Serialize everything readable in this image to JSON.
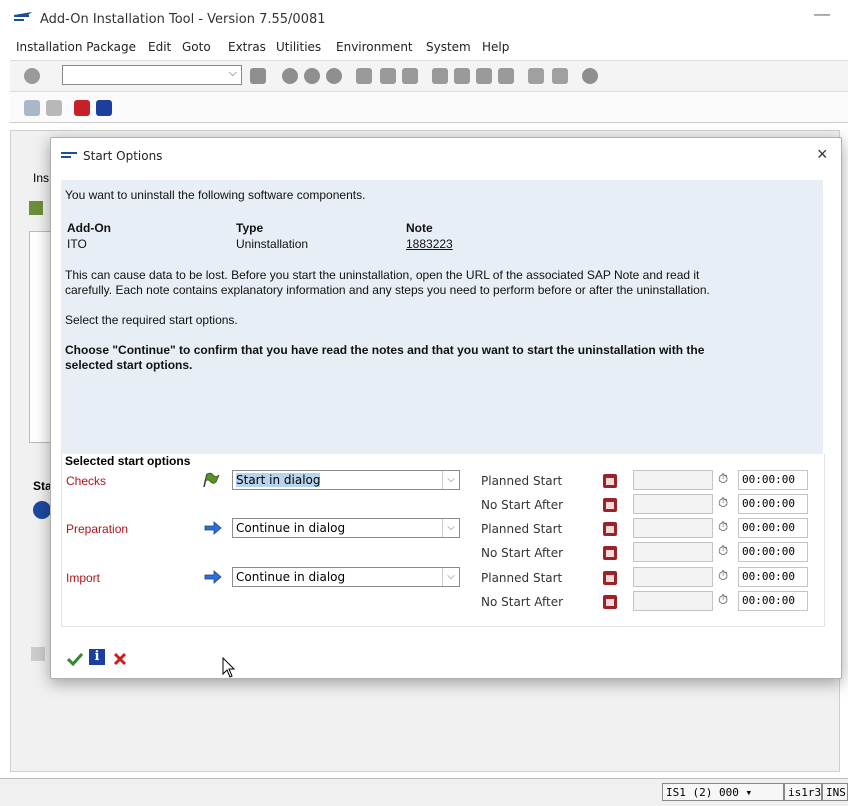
{
  "window": {
    "title": "Add-On Installation Tool - Version 7.55/0081",
    "minimize": "—"
  },
  "menu": [
    "Installation Package",
    "Edit",
    "Goto",
    "Extras",
    "Utilities",
    "Environment",
    "System",
    "Help"
  ],
  "background": {
    "tab_fragment": "Ins",
    "status_fragment": "Sta"
  },
  "statusbar": {
    "system": "IS1 (2) 000",
    "server": "is1r3",
    "mode": "INS"
  },
  "dialog": {
    "title": "Start Options",
    "close": "×",
    "intro": "You want to uninstall the following software components.",
    "columns": {
      "addon": "Add-On",
      "type": "Type",
      "note": "Note"
    },
    "row": {
      "addon": "ITO",
      "type": "Uninstallation",
      "note": "1883223"
    },
    "warning_line1": "This can cause data to be lost. Before you start the uninstallation, open the URL of the associated SAP Note and read it",
    "warning_line2": "carefully. Each note contains explanatory information and any steps you need to perform before or after the uninstallation.",
    "select_hint": "Select the required start options.",
    "confirm_line1": "Choose \"Continue\" to confirm that you have read the notes and that you want to start the uninstallation with the",
    "confirm_line2": "selected start options.",
    "options_header": "Selected start options",
    "phases": [
      {
        "name": "Checks",
        "mode": "Start in dialog",
        "icon": "flag-icon"
      },
      {
        "name": "Preparation",
        "mode": "Continue in dialog",
        "icon": "arrow-icon"
      },
      {
        "name": "Import",
        "mode": "Continue in dialog",
        "icon": "arrow-icon"
      }
    ],
    "schedule_labels": {
      "planned": "Planned Start",
      "no_after": "No Start After"
    },
    "time_default": "00:00:00"
  },
  "colors": {
    "accent_red": "#b3141a",
    "info_bg": "#e8eef5",
    "link": "#1e5ccc"
  }
}
